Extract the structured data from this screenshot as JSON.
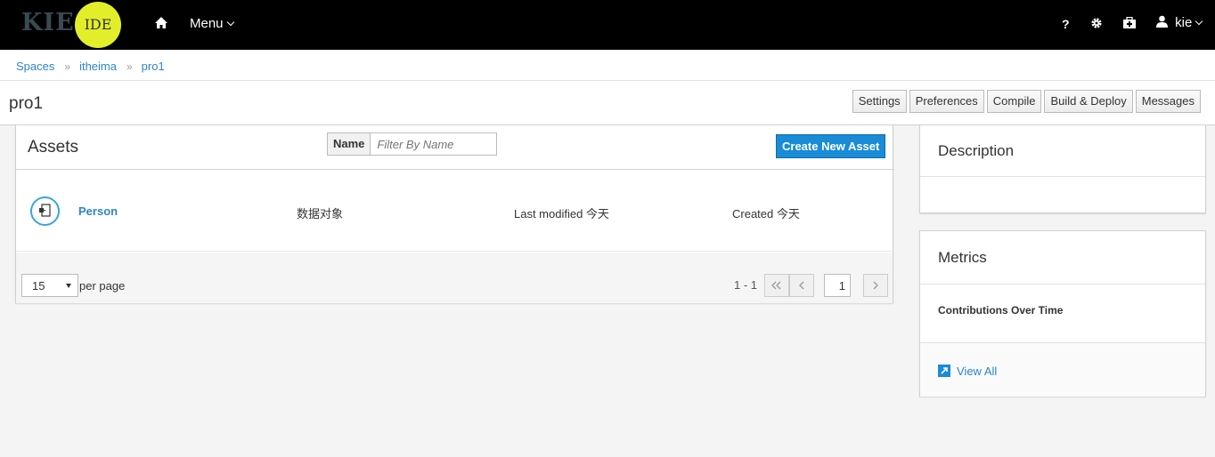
{
  "app": {
    "logo_main": "KIE",
    "logo_badge": "IDE",
    "menu_label": "Menu",
    "user_label": "kie",
    "help_label": "?"
  },
  "breadcrumb": {
    "items": [
      "Spaces",
      "itheima",
      "pro1"
    ],
    "separator": "»"
  },
  "header": {
    "title": "pro1",
    "buttons": [
      "Settings",
      "Preferences",
      "Compile",
      "Build & Deploy",
      "Messages"
    ]
  },
  "assets": {
    "title": "Assets",
    "filter_label": "Name",
    "filter_placeholder": "Filter By Name",
    "create_label": "Create New Asset",
    "rows": [
      {
        "name": "Person",
        "type": "数据对象",
        "modified": "Last modified 今天",
        "created": "Created 今天"
      }
    ],
    "per_page_value": "15",
    "per_page_label": "per page",
    "range": "1 - 1",
    "current_page": "1"
  },
  "description": {
    "title": "Description"
  },
  "metrics": {
    "title": "Metrics",
    "contributions_label": "Contributions Over Time",
    "view_all_label": "View All"
  },
  "colors": {
    "navbar": "#000000",
    "accent": "#1a8bd6",
    "link": "#2c85c8",
    "logo_badge": "#e3ee2a"
  }
}
